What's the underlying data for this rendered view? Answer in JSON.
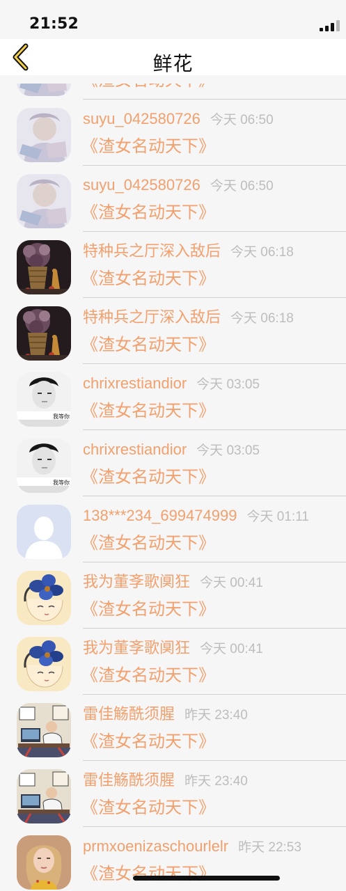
{
  "status": {
    "time": "21:52"
  },
  "nav": {
    "title": "鲜花",
    "back_icon": "chevron-left-icon",
    "accent": "#f2a06d"
  },
  "rows": [
    {
      "name": "",
      "time": "",
      "book": "《渣女名动天下》",
      "avatar": "portrait-faded"
    },
    {
      "name": "suyu_042580726",
      "time": "今天 06:50",
      "book": "《渣女名动天下》",
      "avatar": "portrait-faded"
    },
    {
      "name": "suyu_042580726",
      "time": "今天 06:50",
      "book": "《渣女名动天下》",
      "avatar": "portrait-faded"
    },
    {
      "name": "特种兵之厅深入敌后",
      "time": "今天 06:18",
      "book": "《渣女名动天下》",
      "avatar": "still-life-flowers"
    },
    {
      "name": "特种兵之厅深入敌后",
      "time": "今天 06:18",
      "book": "《渣女名动天下》",
      "avatar": "still-life-flowers"
    },
    {
      "name": "chrixrestiandior",
      "time": "今天 03:05",
      "book": "《渣女名动天下》",
      "avatar": "bw-portrait",
      "avatar_caption": "我等你"
    },
    {
      "name": "chrixrestiandior",
      "time": "今天 03:05",
      "book": "《渣女名动天下》",
      "avatar": "bw-portrait",
      "avatar_caption": "我等你"
    },
    {
      "name": "138***234_699474999",
      "time": "今天 01:11",
      "book": "《渣女名动天下》",
      "avatar": "default-user"
    },
    {
      "name": "我为董斈歌阒狂",
      "time": "今天 00:41",
      "book": "《渣女名动天下》",
      "avatar": "blue-flower-girl"
    },
    {
      "name": "我为董斈歌阒狂",
      "time": "今天 00:41",
      "book": "《渣女名动天下》",
      "avatar": "blue-flower-girl"
    },
    {
      "name": "雷佳觞酰须腥",
      "time": "昨天 23:40",
      "book": "《渣女名动天下》",
      "avatar": "office-illustration"
    },
    {
      "name": "雷佳觞酰须腥",
      "time": "昨天 23:40",
      "book": "《渣女名动天下》",
      "avatar": "office-illustration"
    },
    {
      "name": "prmxoenizaschourlelr",
      "time": "昨天 22:53",
      "book": "《渣女名动天下》",
      "avatar": "girl-photo"
    }
  ]
}
